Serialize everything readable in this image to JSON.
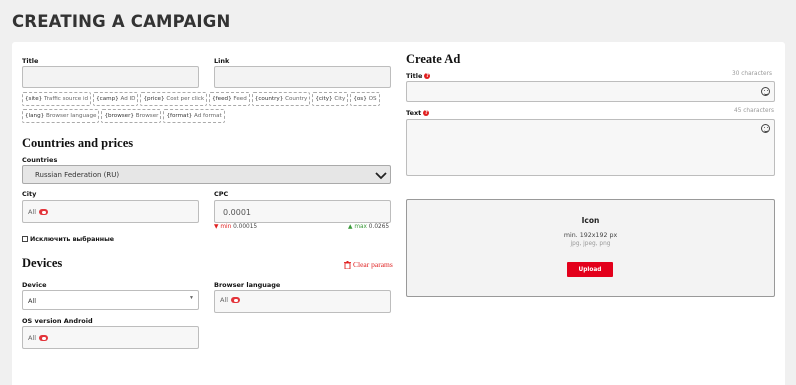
{
  "page": {
    "title": "CREATING A CAMPAIGN"
  },
  "form": {
    "title_label": "Title",
    "link_label": "Link",
    "macros": [
      {
        "key": "{site}",
        "desc": "Traffic source id"
      },
      {
        "key": "{camp}",
        "desc": "Ad ID"
      },
      {
        "key": "{price}",
        "desc": "Cost per click"
      },
      {
        "key": "{feed}",
        "desc": "Feed"
      },
      {
        "key": "{country}",
        "desc": "Country"
      },
      {
        "key": "{city}",
        "desc": "City"
      },
      {
        "key": "{os}",
        "desc": "OS"
      },
      {
        "key": "{lang}",
        "desc": "Browser language"
      },
      {
        "key": "{browser}",
        "desc": "Browser"
      },
      {
        "key": "{format}",
        "desc": "Ad format"
      }
    ],
    "countries_section": "Countries and prices",
    "countries_label": "Countries",
    "countries_value": "Russian Federation (RU)",
    "city_label": "City",
    "city_tag": "All",
    "cpc_label": "CPC",
    "cpc_value": "0.0001",
    "cpc_min_label": "min",
    "cpc_min_value": "0.00015",
    "cpc_max_label": "max",
    "cpc_max_value": "0.0265",
    "exclude_label": "Исключить выбранные",
    "devices_section": "Devices",
    "clear_params": "Clear params",
    "device_label": "Device",
    "device_value": "All",
    "browser_lang_label": "Browser language",
    "browser_lang_tag": "All",
    "os_label": "OS version Android",
    "os_tag": "All"
  },
  "ad": {
    "section": "Create Ad",
    "title_label": "Title",
    "title_limit": "30 characters",
    "text_label": "Text",
    "text_limit": "45 characters",
    "icon_title": "Icon",
    "icon_size": "min. 192x192 px",
    "icon_formats": "jpg, jpeg, png",
    "upload_label": "Upload"
  },
  "colors": {
    "accent": "#e3001b",
    "min": "#e02020",
    "max": "#3a9a3a"
  }
}
